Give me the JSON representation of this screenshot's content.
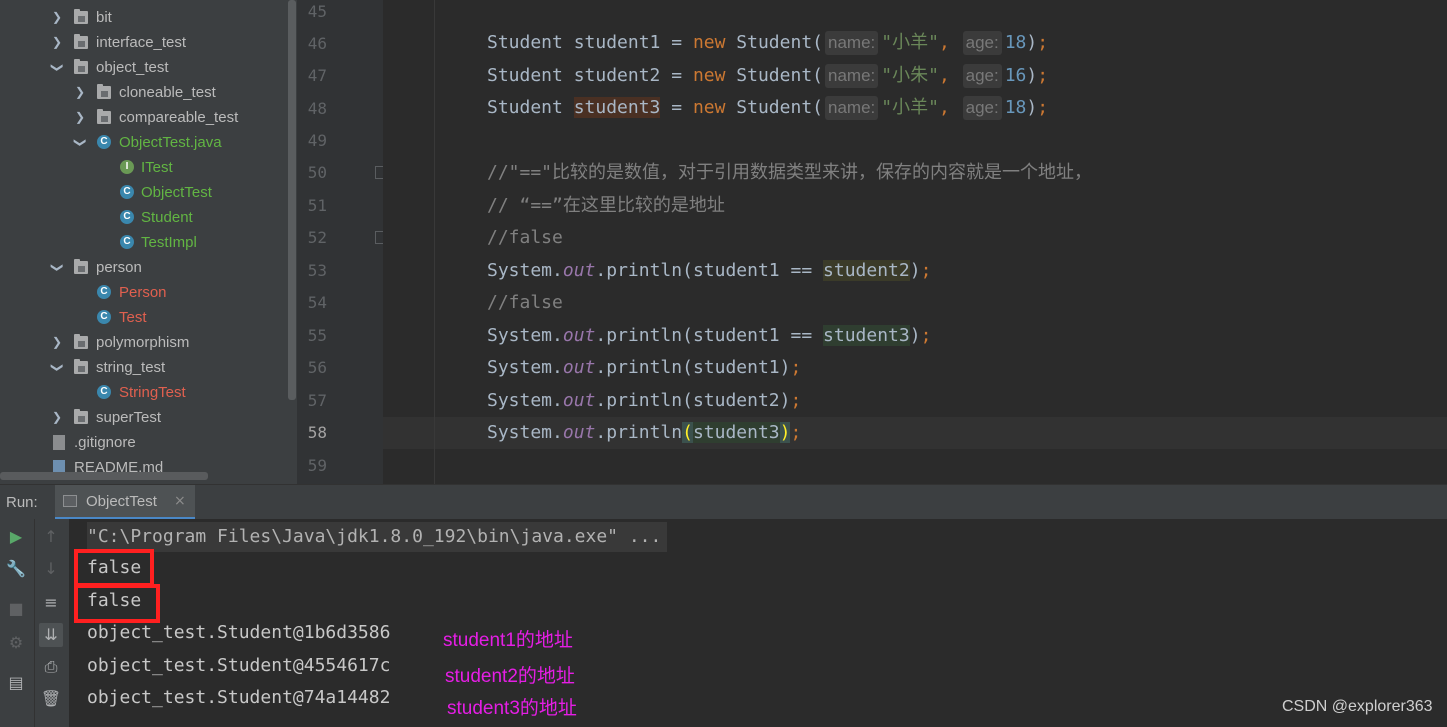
{
  "project_tree": {
    "items": [
      {
        "label": "bit",
        "icon": "folder-icon",
        "expanded": false
      },
      {
        "label": "interface_test",
        "icon": "folder-icon",
        "expanded": false
      },
      {
        "label": "object_test",
        "icon": "folder-icon",
        "expanded": true
      },
      {
        "label": "cloneable_test",
        "icon": "folder-icon",
        "expanded": false
      },
      {
        "label": "compareable_test",
        "icon": "folder-icon",
        "expanded": false
      },
      {
        "label": "ObjectTest.java",
        "icon": "java-class-icon",
        "expanded": true
      },
      {
        "label": "ITest",
        "icon": "interface-icon"
      },
      {
        "label": "ObjectTest",
        "icon": "java-class-icon"
      },
      {
        "label": "Student",
        "icon": "java-class-icon"
      },
      {
        "label": "TestImpl",
        "icon": "java-class-icon"
      },
      {
        "label": "person",
        "icon": "folder-icon",
        "expanded": true
      },
      {
        "label": "Person",
        "icon": "java-class-icon"
      },
      {
        "label": "Test",
        "icon": "java-class-icon"
      },
      {
        "label": "polymorphism",
        "icon": "folder-icon",
        "expanded": false
      },
      {
        "label": "string_test",
        "icon": "folder-icon",
        "expanded": true
      },
      {
        "label": "StringTest",
        "icon": "java-class-icon"
      },
      {
        "label": "superTest",
        "icon": "folder-icon",
        "expanded": false
      },
      {
        "label": ".gitignore",
        "icon": "file-icon"
      },
      {
        "label": "README.md",
        "icon": "markdown-file-icon"
      }
    ]
  },
  "editor": {
    "line_numbers": [
      "45",
      "46",
      "47",
      "48",
      "49",
      "50",
      "51",
      "52",
      "53",
      "54",
      "55",
      "56",
      "57",
      "58",
      "59"
    ],
    "current_line": "58",
    "tokens": {
      "student_type": "Student",
      "new_kw": "new",
      "eq": "=",
      "hint_name": "name:",
      "hint_age": "age:",
      "var1": "student1",
      "var2": "student2",
      "var3": "student3",
      "str1": "\"小羊\"",
      "str2": "\"小朱\"",
      "str3": "\"小羊\"",
      "num1": "18",
      "num2": "16",
      "num3": "18",
      "comment1": "//\"==\"比较的是数值，对于引用数据类型来讲，保存的内容就是一个地址，",
      "comment2": "// “==”在这里比较的是地址",
      "comment_false": "//false",
      "system": "System",
      "out": "out",
      "println": "println",
      "cmp_op": "=="
    }
  },
  "run_panel": {
    "label": "Run:",
    "tab_title": "ObjectTest",
    "tab_close": "×",
    "command_line": "\"C:\\Program Files\\Java\\jdk1.8.0_192\\bin\\java.exe\" ...",
    "output_lines": [
      "false",
      "false",
      "object_test.Student@1b6d3586",
      "object_test.Student@4554617c",
      "object_test.Student@74a14482"
    ],
    "annotations": [
      "student1的地址",
      "student2的地址",
      "student3的地址"
    ],
    "toolbar_icons": [
      "run-icon",
      "wrench-icon",
      "stop-icon",
      "settings-bug-icon",
      "layout-icon",
      "up-arrow-icon",
      "down-arrow-icon",
      "soft-wrap-icon",
      "scroll-to-end-icon",
      "print-icon",
      "trash-icon"
    ]
  },
  "watermark": "CSDN @explorer363",
  "colors": {
    "annotation": "#e51ee5",
    "highlight_box": "#ff2020",
    "keyword": "#cc7832",
    "string": "#6a8759",
    "number": "#6897bb"
  }
}
